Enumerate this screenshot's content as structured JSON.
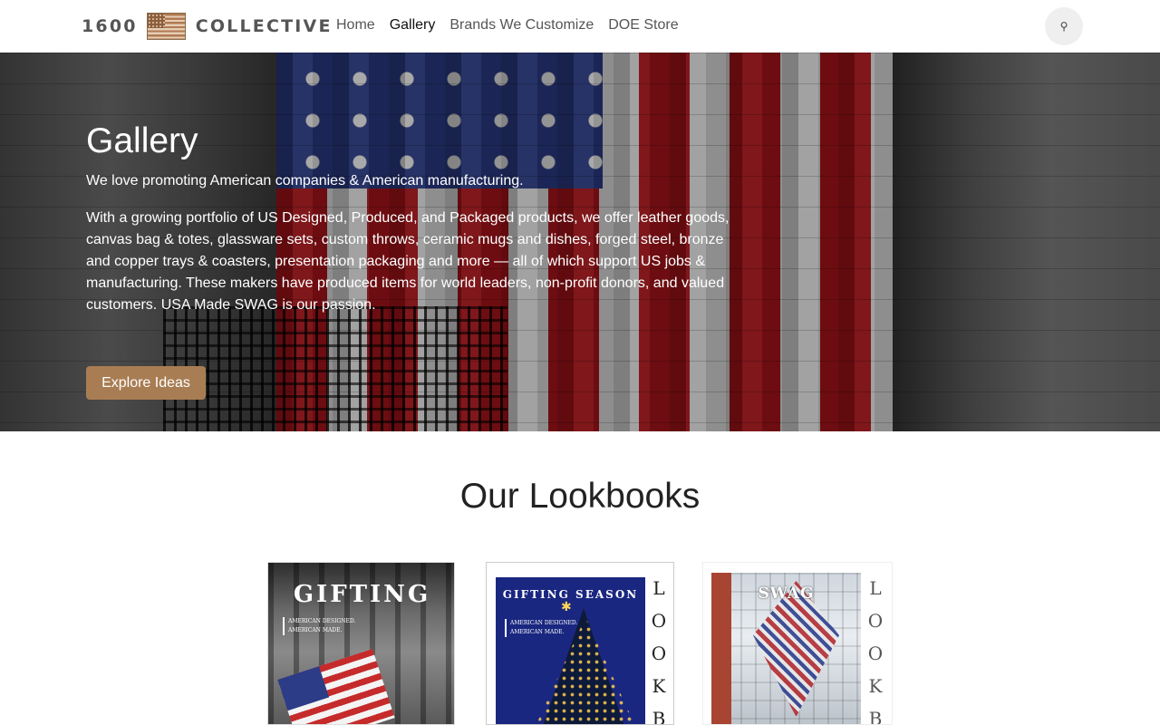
{
  "header": {
    "logo_left": "1600",
    "logo_right": "COLLECTIVE",
    "nav": [
      {
        "label": "Home",
        "active": false
      },
      {
        "label": "Gallery",
        "active": true
      },
      {
        "label": "Brands We Customize",
        "active": false
      },
      {
        "label": "DOE Store",
        "active": false
      }
    ],
    "search_icon": "search-icon"
  },
  "hero": {
    "title": "Gallery",
    "subtitle": "We love promoting American companies & American manufacturing.",
    "body": "With a growing portfolio of US Designed, Produced, and Packaged products, we offer leather goods, canvas bag & totes, glassware sets, custom throws, ceramic mugs and dishes, forged steel, bronze and copper trays & coasters, presentation packaging and more — all of which support US jobs & manufacturing.  These makers have produced items for world leaders, non-profit donors, and valued customers.  USA Made SWAG is our passion.",
    "cta": "Explore Ideas",
    "cta_color": "#a97d53"
  },
  "lookbooks": {
    "title": "Our Lookbooks",
    "items": [
      {
        "cover_title": "GIFTING",
        "tagline_1": "AMERICAN DESIGNED.",
        "tagline_2": "AMERICAN MADE.",
        "side": []
      },
      {
        "cover_title": "GIFTING SEASON",
        "tagline_1": "AMERICAN DESIGNED.",
        "tagline_2": "AMERICAN MADE.",
        "side": [
          "L",
          "O",
          "O",
          "K",
          "B"
        ]
      },
      {
        "cover_title": "SWAG",
        "tagline_1": "",
        "tagline_2": "",
        "side": [
          "L",
          "O",
          "O",
          "K",
          "B"
        ]
      }
    ]
  }
}
